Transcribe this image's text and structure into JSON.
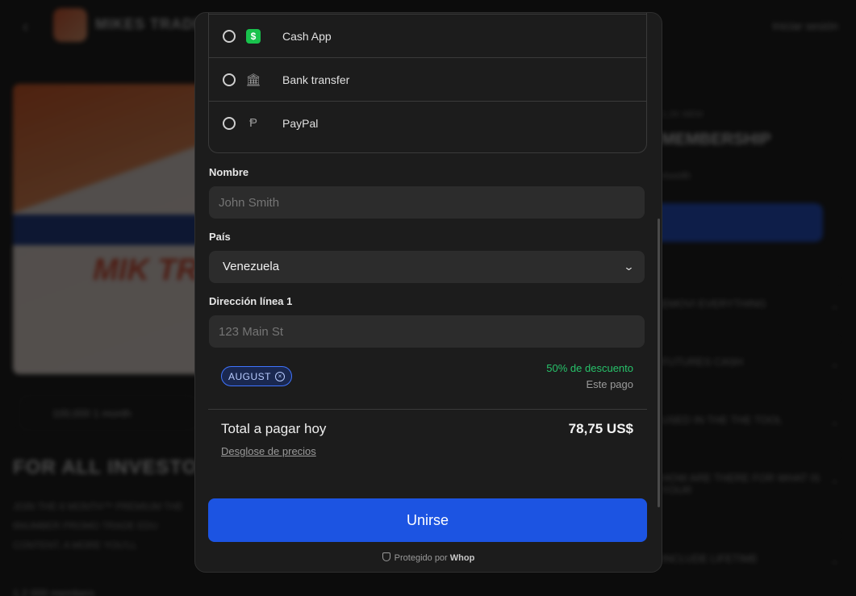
{
  "background": {
    "back_icon": "‹",
    "brand": "MIKES TRADE",
    "login": "Iniciar sesión",
    "hero_text": "MIK TR",
    "joined": "100,000 1 month",
    "heading": "FOR ALL INVESTO",
    "paragraph": "JOIN THE 6 MONTH™ PREMIUM THE 6NUMBER PROMO TRADE EDU CONTENT, A MORE YOU'LL",
    "stat": "1.2 000 members",
    "right_sub": "1.2K MEM",
    "right_title": "MEMBERSHIP",
    "right_meta": "month",
    "faq": [
      {
        "label": "EMOVI EVERYTHING",
        "chevron": "⌄"
      },
      {
        "label": "FUTURES CASH",
        "chevron": "⌄"
      },
      {
        "label": "USED IN THE THE TOOL",
        "chevron": "⌄"
      },
      {
        "label": "HOW ARE THERE FOR WHAT IS YOUR",
        "chevron": "⌄"
      },
      {
        "label": "INCLUDE LIFETIME",
        "chevron": "⌄"
      }
    ]
  },
  "payment_methods": [
    {
      "label": "Cash App",
      "icon": "cash-app-icon",
      "glyph": "$",
      "selected": false
    },
    {
      "label": "Bank transfer",
      "icon": "bank-icon",
      "glyph": "🏛",
      "selected": false
    },
    {
      "label": "PayPal",
      "icon": "paypal-icon",
      "glyph": "Ᵽ",
      "selected": false
    }
  ],
  "form": {
    "name_label": "Nombre",
    "name_placeholder": "John Smith",
    "country_label": "País",
    "country_value": "Venezuela",
    "country_chevron": "⌄",
    "address_label": "Dirección línea 1",
    "address_placeholder": "123 Main St"
  },
  "coupon": {
    "code": "AUGUST",
    "remove_glyph": "×",
    "discount": "50% de descuento",
    "discount_note": "Este pago"
  },
  "total": {
    "label": "Total a pagar hoy",
    "value": "78,75 US$",
    "breakdown_link": "Desglose de precios"
  },
  "join_button": "Unirse",
  "footer": {
    "protected_prefix": "Protegido por",
    "brand": "Whop"
  },
  "colors": {
    "accent": "#1c54e2",
    "discount": "#27c26a",
    "coupon_border": "#3f74ff",
    "cash_app": "#19c24d"
  }
}
